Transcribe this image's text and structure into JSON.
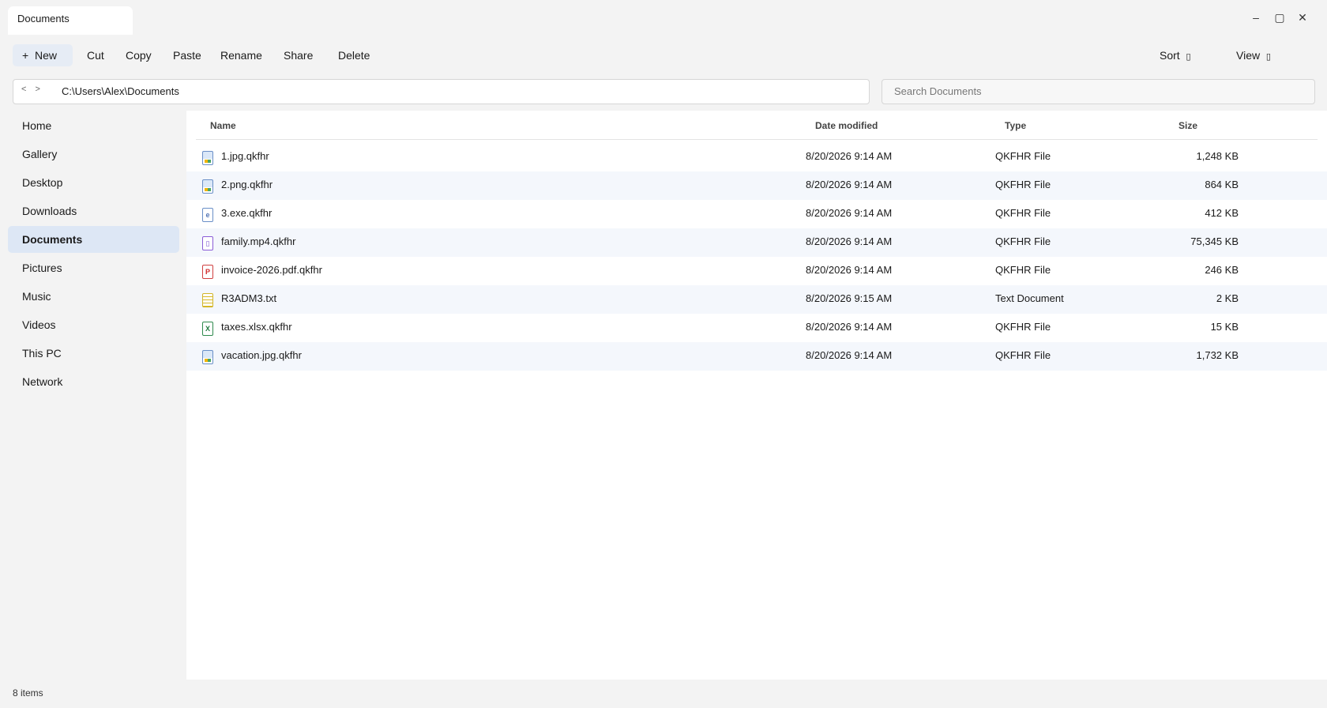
{
  "window": {
    "tab_title": "Documents",
    "controls": {
      "minimize": "–",
      "maximize": "▢",
      "close": "✕"
    }
  },
  "toolbar": {
    "new_label": "New",
    "new_icon": "+",
    "cut": "Cut",
    "copy": "Copy",
    "paste": "Paste",
    "rename": "Rename",
    "share": "Share",
    "delete": "Delete",
    "sort": "Sort",
    "view": "View",
    "dropdown_glyph": "▯"
  },
  "address": {
    "back": "<",
    "forward": ">",
    "path": "C:\\Users\\Alex\\Documents"
  },
  "search": {
    "placeholder": "Search Documents"
  },
  "sidebar": {
    "items": [
      {
        "label": "Home"
      },
      {
        "label": "Gallery"
      },
      {
        "label": "Desktop"
      },
      {
        "label": "Downloads"
      },
      {
        "label": "Documents",
        "active": true
      },
      {
        "label": "Pictures"
      },
      {
        "label": "Music"
      },
      {
        "label": "Videos"
      },
      {
        "label": "This PC"
      },
      {
        "label": "Network"
      }
    ]
  },
  "columns": {
    "name": "Name",
    "date": "Date modified",
    "type": "Type",
    "size": "Size"
  },
  "files": [
    {
      "name": "1.jpg.qkfhr",
      "date": "8/20/2026 9:14 AM",
      "type": "QKFHR File",
      "size": "1,248 KB",
      "icon": "image-file-icon",
      "glyph": ""
    },
    {
      "name": "2.png.qkfhr",
      "date": "8/20/2026 9:14 AM",
      "type": "QKFHR File",
      "size": "864 KB",
      "icon": "image-file-icon",
      "glyph": ""
    },
    {
      "name": "3.exe.qkfhr",
      "date": "8/20/2026 9:14 AM",
      "type": "QKFHR File",
      "size": "412 KB",
      "icon": "executable-file-icon",
      "glyph": "e"
    },
    {
      "name": "family.mp4.qkfhr",
      "date": "8/20/2026 9:14 AM",
      "type": "QKFHR File",
      "size": "75,345 KB",
      "icon": "video-file-icon",
      "glyph": "▯"
    },
    {
      "name": "invoice-2026.pdf.qkfhr",
      "date": "8/20/2026 9:14 AM",
      "type": "QKFHR File",
      "size": "246 KB",
      "icon": "pdf-file-icon",
      "glyph": "P"
    },
    {
      "name": "R3ADM3.txt",
      "date": "8/20/2026 9:15 AM",
      "type": "Text Document",
      "size": "2 KB",
      "icon": "text-file-icon",
      "glyph": ""
    },
    {
      "name": "taxes.xlsx.qkfhr",
      "date": "8/20/2026 9:14 AM",
      "type": "QKFHR File",
      "size": "15 KB",
      "icon": "spreadsheet-file-icon",
      "glyph": "X"
    },
    {
      "name": "vacation.jpg.qkfhr",
      "date": "8/20/2026 9:14 AM",
      "type": "QKFHR File",
      "size": "1,732 KB",
      "icon": "image-file-icon",
      "glyph": ""
    }
  ],
  "status": {
    "item_count": "8 items"
  }
}
